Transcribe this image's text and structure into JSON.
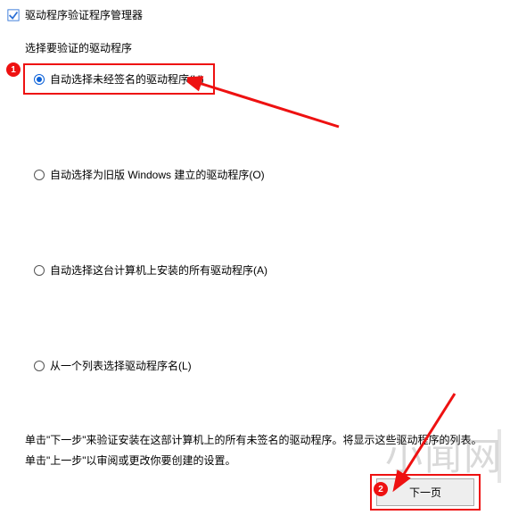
{
  "window": {
    "title": "驱动程序验证程序管理器"
  },
  "section": {
    "heading": "选择要验证的驱动程序"
  },
  "options": {
    "opt_unsigned": "自动选择未经签名的驱动程序(U)",
    "opt_oldwin": "自动选择为旧版 Windows 建立的驱动程序(O)",
    "opt_all": "自动选择这台计算机上安装的所有驱动程序(A)",
    "opt_list": "从一个列表选择驱动程序名(L)"
  },
  "hints": {
    "line1": "单击\"下一步\"来验证安装在这部计算机上的所有未签名的驱动程序。将显示这些驱动程序的列表。",
    "line2": "单击\"上一步\"以审阅或更改你要创建的设置。"
  },
  "buttons": {
    "next": "下一页"
  },
  "annotations": {
    "step1": "1",
    "step2": "2"
  },
  "watermark": "小闻网"
}
